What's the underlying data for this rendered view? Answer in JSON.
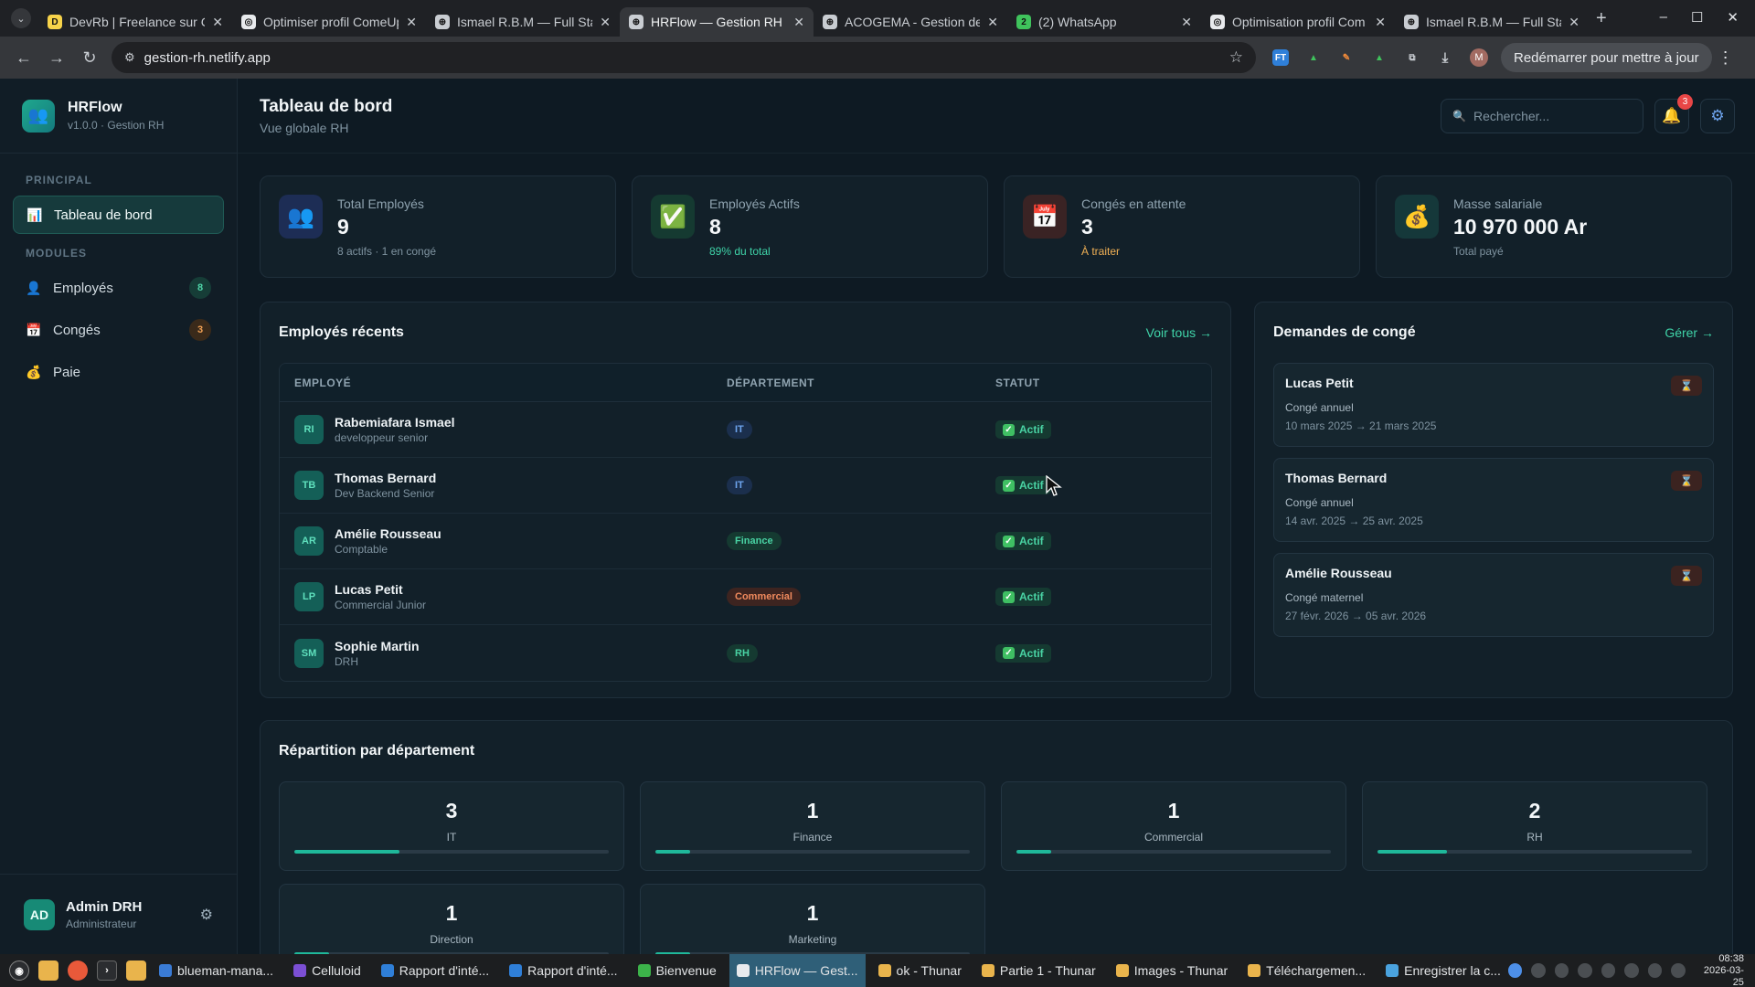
{
  "browser": {
    "tabs": [
      {
        "title": "DevRb | Freelance sur Co",
        "fav_color": "#f7d34a",
        "fav_text": "D",
        "active": false
      },
      {
        "title": "Optimiser profil ComeUp",
        "fav_color": "#e8eaed",
        "fav_text": "◎",
        "active": false
      },
      {
        "title": "Ismael R.B.M — Full Stac",
        "fav_color": "#c9cdd2",
        "fav_text": "⊕",
        "active": false
      },
      {
        "title": "HRFlow — Gestion RH",
        "fav_color": "#c9cdd2",
        "fav_text": "⊕",
        "active": true
      },
      {
        "title": "ACOGEMA - Gestion de l",
        "fav_color": "#c9cdd2",
        "fav_text": "⊕",
        "active": false
      },
      {
        "title": "(2) WhatsApp",
        "fav_color": "#3fc35c",
        "fav_text": "2",
        "active": false
      },
      {
        "title": "Optimisation profil Com",
        "fav_color": "#e8eaed",
        "fav_text": "◎",
        "active": false
      },
      {
        "title": "Ismael R.B.M — Full Stac",
        "fav_color": "#c9cdd2",
        "fav_text": "⊕",
        "active": false
      }
    ],
    "url": "gestion-rh.netlify.app",
    "restart_label": "Redémarrer pour mettre à jour",
    "profile_initial": "M"
  },
  "sidebar": {
    "brand_name": "HRFlow",
    "brand_version": "v1.0.0 · Gestion RH",
    "section_principal": "PRINCIPAL",
    "section_modules": "MODULES",
    "dashboard_label": "Tableau de bord",
    "items": [
      {
        "label": "Employés",
        "badge": "8",
        "badge_kind": "green",
        "icon": "👤"
      },
      {
        "label": "Congés",
        "badge": "3",
        "badge_kind": "orange",
        "icon": "📅"
      },
      {
        "label": "Paie",
        "badge": "",
        "badge_kind": "",
        "icon": "💰"
      }
    ],
    "user": {
      "initials": "AD",
      "name": "Admin DRH",
      "role": "Administrateur"
    }
  },
  "header": {
    "title": "Tableau de bord",
    "subtitle": "Vue globale RH",
    "search_placeholder": "Rechercher...",
    "notif_count": "3"
  },
  "stats": [
    {
      "label": "Total Employés",
      "value": "9",
      "note": "8 actifs · 1 en congé",
      "note_color": "#7f93a0",
      "icon": "👥",
      "icon_bg": "#1d2d55"
    },
    {
      "label": "Employés Actifs",
      "value": "8",
      "note": "89% du total",
      "note_color": "#3fd3a8",
      "icon": "✅",
      "icon_bg": "#153a31"
    },
    {
      "label": "Congés en attente",
      "value": "3",
      "note": "À traiter",
      "note_color": "#f0b055",
      "icon": "📅",
      "icon_bg": "#3a2324"
    },
    {
      "label": "Masse salariale",
      "value": "10 970 000 Ar",
      "note": "Total payé",
      "note_color": "#7f93a0",
      "icon": "💰",
      "icon_bg": "#15383a"
    }
  ],
  "recent": {
    "title": "Employés récents",
    "link": "Voir tous →",
    "columns": [
      "EMPLOYÉ",
      "DÉPARTEMENT",
      "STATUT"
    ],
    "rows": [
      {
        "initials": "RI",
        "name": "Rabemiafara Ismael",
        "role": "developpeur senior",
        "dept": "IT",
        "status": "Actif"
      },
      {
        "initials": "TB",
        "name": "Thomas Bernard",
        "role": "Dev Backend Senior",
        "dept": "IT",
        "status": "Actif"
      },
      {
        "initials": "AR",
        "name": "Amélie Rousseau",
        "role": "Comptable",
        "dept": "Finance",
        "status": "Actif"
      },
      {
        "initials": "LP",
        "name": "Lucas Petit",
        "role": "Commercial Junior",
        "dept": "Commercial",
        "status": "Actif"
      },
      {
        "initials": "SM",
        "name": "Sophie Martin",
        "role": "DRH",
        "dept": "RH",
        "status": "Actif"
      }
    ],
    "dept_colors": {
      "IT": {
        "bg": "#1b2f4d",
        "fg": "#6ea4ee"
      },
      "Finance": {
        "bg": "#153a31",
        "fg": "#49d3a4"
      },
      "Commercial": {
        "bg": "#3d2420",
        "fg": "#f08a5d"
      },
      "RH": {
        "bg": "#153a31",
        "fg": "#49d3a4"
      }
    }
  },
  "leaves": {
    "title": "Demandes de congé",
    "link": "Gérer →",
    "items": [
      {
        "name": "Lucas Petit",
        "type": "Congé annuel",
        "dates": "10 mars 2025 → 21 mars 2025"
      },
      {
        "name": "Thomas Bernard",
        "type": "Congé annuel",
        "dates": "14 avr. 2025 → 25 avr. 2025"
      },
      {
        "name": "Amélie Rousseau",
        "type": "Congé maternel",
        "dates": "27 févr. 2026 → 05 avr. 2026"
      }
    ]
  },
  "departments": {
    "title": "Répartition par département",
    "items": [
      {
        "count": "3",
        "name": "IT",
        "share": 0.333
      },
      {
        "count": "1",
        "name": "Finance",
        "share": 0.111
      },
      {
        "count": "1",
        "name": "Commercial",
        "share": 0.111
      },
      {
        "count": "2",
        "name": "RH",
        "share": 0.222
      },
      {
        "count": "1",
        "name": "Direction",
        "share": 0.111
      },
      {
        "count": "1",
        "name": "Marketing",
        "share": 0.111
      }
    ]
  },
  "taskbar": {
    "tasks": [
      {
        "label": "blueman-mana...",
        "color": "#3a7bd5",
        "active": false
      },
      {
        "label": "Celluloid",
        "color": "#7b4fd4",
        "active": false
      },
      {
        "label": "Rapport d'inté...",
        "color": "#2f7fd8",
        "active": false
      },
      {
        "label": "Rapport d'inté...",
        "color": "#2f7fd8",
        "active": false
      },
      {
        "label": "Bienvenue",
        "color": "#3cb34a",
        "active": false
      },
      {
        "label": "HRFlow — Gest...",
        "color": "#e8eaed",
        "active": true
      },
      {
        "label": "ok - Thunar",
        "color": "#e9b44c",
        "active": false
      },
      {
        "label": "Partie 1 - Thunar",
        "color": "#e9b44c",
        "active": false
      },
      {
        "label": "Images - Thunar",
        "color": "#e9b44c",
        "active": false
      },
      {
        "label": "Téléchargemen...",
        "color": "#e9b44c",
        "active": false
      },
      {
        "label": "Enregistrer la c...",
        "color": "#4aa3df",
        "active": false
      }
    ],
    "time": "08:38",
    "date": "2026-03-25"
  }
}
